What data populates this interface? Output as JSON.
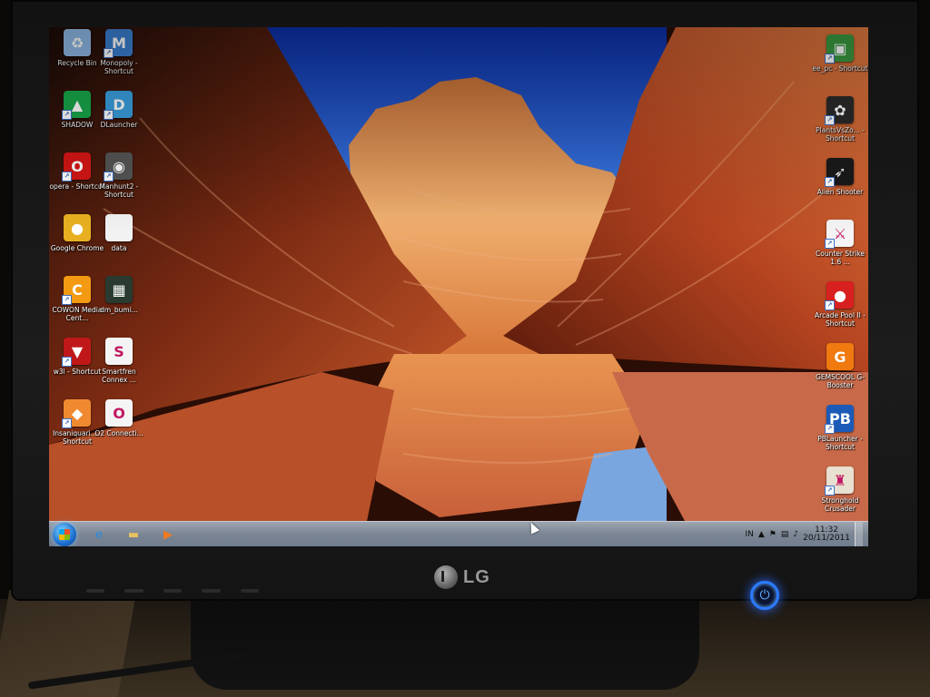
{
  "monitor": {
    "brand": "LG"
  },
  "desktop_icons_left": [
    {
      "label": "Recycle Bin",
      "icon": "recycle-bin-icon",
      "color": "#8fb9e6",
      "glyph": "♻",
      "shortcut": false
    },
    {
      "label": "Monopoly - Shortcut",
      "icon": "monopoly-icon",
      "color": "#3a7fd0",
      "glyph": "M",
      "shortcut": true
    },
    {
      "label": "SHADOW",
      "icon": "shadow-icon",
      "color": "#18a84a",
      "glyph": "▲",
      "shortcut": true
    },
    {
      "label": "DLauncher",
      "icon": "dlauncher-icon",
      "color": "#3aa0e0",
      "glyph": "D",
      "shortcut": true
    },
    {
      "label": "opera - Shortcut",
      "icon": "opera-icon",
      "color": "#d41515",
      "glyph": "O",
      "shortcut": true
    },
    {
      "label": "Manhunt2 - Shortcut",
      "icon": "manhunt2-icon",
      "color": "#555555",
      "glyph": "◉",
      "shortcut": true
    },
    {
      "label": "Google Chrome",
      "icon": "chrome-icon",
      "color": "#e8b020",
      "glyph": "●",
      "shortcut": false
    },
    {
      "label": "data",
      "icon": "file-icon",
      "color": "#f2f2f2",
      "glyph": "",
      "shortcut": false
    },
    {
      "label": "COWON Media Cent...",
      "icon": "cowon-icon",
      "color": "#f39a12",
      "glyph": "C",
      "shortcut": true
    },
    {
      "label": "dm_bumi...",
      "icon": "image-file-icon",
      "color": "#2a3a30",
      "glyph": "▦",
      "shortcut": false
    },
    {
      "label": "w3l - Shortcut",
      "icon": "w3l-icon",
      "color": "#c01818",
      "glyph": "▼",
      "shortcut": true
    },
    {
      "label": "Smartfren Connex ...",
      "icon": "smartfren-icon",
      "color": "#f4f4f4",
      "glyph": "S",
      "shortcut": false
    },
    {
      "label": "Insaniquari... - Shortcut",
      "icon": "insaniquarium-icon",
      "color": "#f08a30",
      "glyph": "◆",
      "shortcut": true
    },
    {
      "label": "O2 Connecti...",
      "icon": "o2-icon",
      "color": "#f4f4f4",
      "glyph": "O",
      "shortcut": false
    }
  ],
  "desktop_icons_right": [
    {
      "label": "ee_pc - Shortcut",
      "icon": "ee-pc-icon",
      "color": "#3a9a40",
      "glyph": "▣",
      "shortcut": true
    },
    {
      "label": "PlantsVsZo... - Shortcut",
      "icon": "plants-vs-zombies-icon",
      "color": "#2a2a2a",
      "glyph": "✿",
      "shortcut": true
    },
    {
      "label": "Alien Shooter",
      "icon": "alien-shooter-icon",
      "color": "#1a1a1a",
      "glyph": "➶",
      "shortcut": true
    },
    {
      "label": "Counter Strike 1.6 ...",
      "icon": "counter-strike-icon",
      "color": "#f4f4f4",
      "glyph": "⚔",
      "shortcut": true
    },
    {
      "label": "Arcade Pool II - Shortcut",
      "icon": "arcade-pool-icon",
      "color": "#d82020",
      "glyph": "●",
      "shortcut": true
    },
    {
      "label": "GEMSCOOL G-Booster",
      "icon": "gemscool-icon",
      "color": "#f07a10",
      "glyph": "G",
      "shortcut": false
    },
    {
      "label": "PBLauncher - Shortcut",
      "icon": "pblauncher-icon",
      "color": "#1c5ab8",
      "glyph": "PB",
      "shortcut": true
    },
    {
      "label": "Stronghold Crusader",
      "icon": "stronghold-icon",
      "color": "#e8e0d0",
      "glyph": "♜",
      "shortcut": true
    }
  ],
  "taskbar": {
    "pins": [
      {
        "name": "internet-explorer-icon",
        "glyph": "e",
        "color": "#2a8ae0"
      },
      {
        "name": "folder-icon",
        "glyph": "▬",
        "color": "#e8c060"
      },
      {
        "name": "media-player-icon",
        "glyph": "▶",
        "color": "#f07a20"
      }
    ],
    "tray": {
      "lang": "IN",
      "time": "11:32",
      "date": "20/11/2011"
    }
  }
}
